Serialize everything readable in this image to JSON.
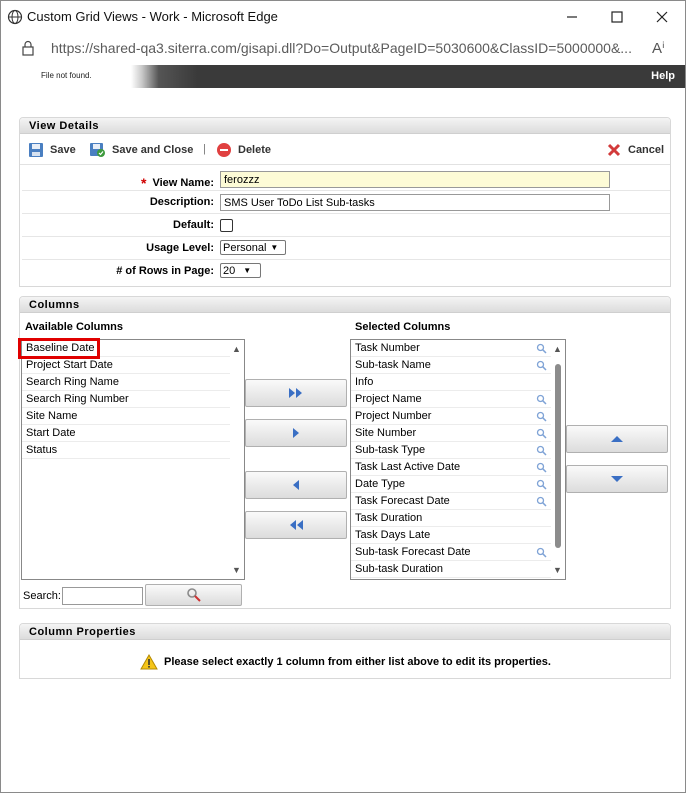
{
  "window": {
    "title": "Custom Grid Views - Work - Microsoft Edge"
  },
  "browser": {
    "url": "https://shared-qa3.siterra.com/gisapi.dll?Do=Output&PageID=5030600&ClassID=5000000&..."
  },
  "header": {
    "file_not_found": "File not found.",
    "help": "Help"
  },
  "view_details": {
    "title": "View Details",
    "toolbar": {
      "save": "Save",
      "save_close": "Save and Close",
      "separator": "|",
      "delete": "Delete",
      "cancel": "Cancel"
    },
    "fields": {
      "view_name_label": "View Name:",
      "view_name_value": "ferozzz",
      "description_label": "Description:",
      "description_value": "SMS User ToDo List Sub-tasks",
      "default_label": "Default:",
      "usage_level_label": "Usage Level:",
      "usage_level_value": "Personal",
      "rows_label": "# of Rows in Page:",
      "rows_value": "20"
    }
  },
  "columns": {
    "title": "Columns",
    "available_label": "Available Columns",
    "selected_label": "Selected Columns",
    "available": [
      "Baseline Date",
      "Project Start Date",
      "Search Ring Name",
      "Search Ring Number",
      "Site Name",
      "Start Date",
      "Status"
    ],
    "selected": [
      {
        "name": "Task Number",
        "search": true
      },
      {
        "name": "Sub-task Name",
        "search": true
      },
      {
        "name": "Info",
        "search": false
      },
      {
        "name": "Project Name",
        "search": true
      },
      {
        "name": "Project Number",
        "search": true
      },
      {
        "name": "Site Number",
        "search": true
      },
      {
        "name": "Sub-task Type",
        "search": true
      },
      {
        "name": "Task Last Active Date",
        "search": true
      },
      {
        "name": "Date Type",
        "search": true
      },
      {
        "name": "Task Forecast Date",
        "search": true
      },
      {
        "name": "Task Duration",
        "search": false
      },
      {
        "name": "Task Days Late",
        "search": false
      },
      {
        "name": "Sub-task Forecast Date",
        "search": true
      },
      {
        "name": "Sub-task Duration",
        "search": false
      }
    ],
    "search_label": "Search:"
  },
  "column_properties": {
    "title": "Column Properties",
    "message": "Please select exactly 1 column from either list above to edit its properties."
  }
}
